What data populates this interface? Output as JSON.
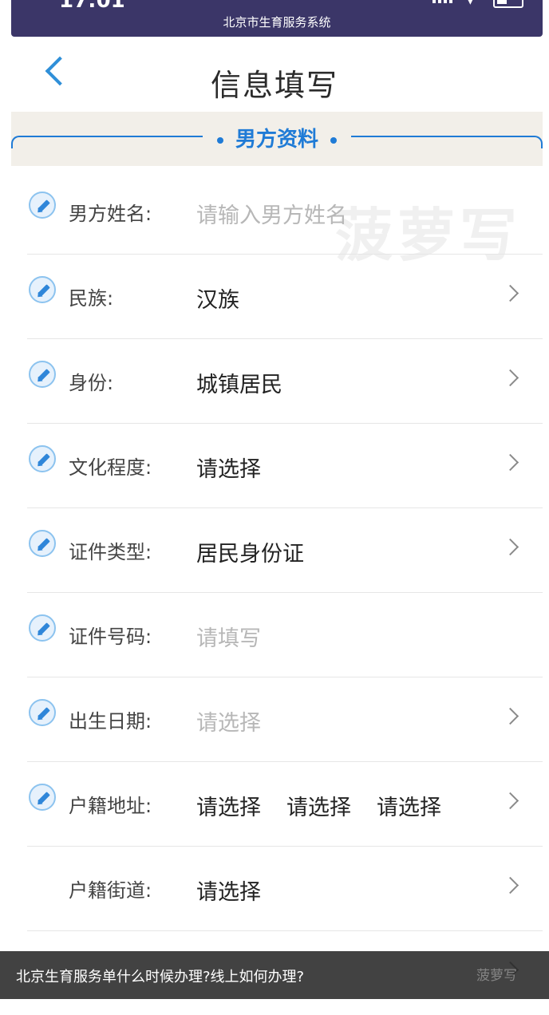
{
  "status_bar": {
    "time": "17:01",
    "title": "北京市生育服务系统"
  },
  "nav": {
    "title": "信息填写"
  },
  "section": {
    "title": "男方资料"
  },
  "watermark": "菠萝写",
  "form": {
    "rows": [
      {
        "label": "男方姓名:",
        "value": "请输入男方姓名",
        "is_placeholder": true,
        "has_chevron": false,
        "has_edit_icon": true
      },
      {
        "label": "民族:",
        "value": "汉族",
        "is_placeholder": false,
        "has_chevron": true,
        "has_edit_icon": true
      },
      {
        "label": "身份:",
        "value": "城镇居民",
        "is_placeholder": false,
        "has_chevron": true,
        "has_edit_icon": true
      },
      {
        "label": "文化程度:",
        "value": "请选择",
        "is_placeholder": false,
        "has_chevron": true,
        "has_edit_icon": true
      },
      {
        "label": "证件类型:",
        "value": "居民身份证",
        "is_placeholder": false,
        "has_chevron": true,
        "has_edit_icon": true
      },
      {
        "label": "证件号码:",
        "value": "请填写",
        "is_placeholder": true,
        "has_chevron": false,
        "has_edit_icon": true
      },
      {
        "label": "出生日期:",
        "value": "请选择",
        "is_placeholder": true,
        "has_chevron": true,
        "has_edit_icon": true
      },
      {
        "label": "户籍地址:",
        "values": [
          "请选择",
          "请选择",
          "请选择"
        ],
        "is_placeholder": false,
        "has_chevron": true,
        "has_edit_icon": true
      },
      {
        "label": "户籍街道:",
        "value": "请选择",
        "is_placeholder": false,
        "has_chevron": true,
        "has_edit_icon": false
      }
    ]
  },
  "caption": {
    "text": "北京生育服务单什么时候办理?线上如何办理?",
    "logo": "菠萝写"
  },
  "colors": {
    "status_bar_bg": "#3b3668",
    "accent_blue": "#1f7bd6",
    "section_bg": "#f2efe9",
    "placeholder": "#b7b7b7"
  }
}
